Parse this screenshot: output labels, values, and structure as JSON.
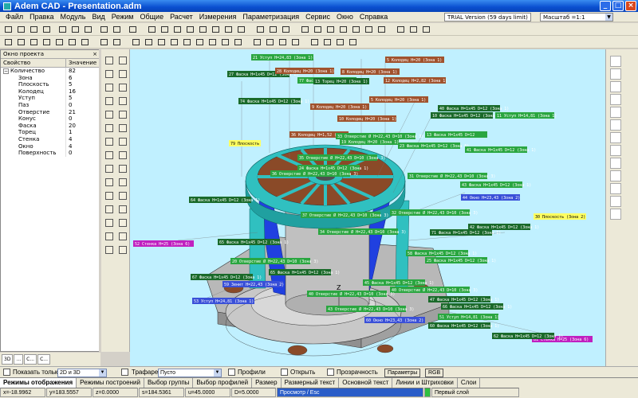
{
  "window": {
    "title": "Adem CAD - Presentation.adm"
  },
  "menu": [
    "Файл",
    "Правка",
    "Модуль",
    "Вид",
    "Режим",
    "Общие",
    "Расчет",
    "Измерения",
    "Параметризация",
    "Сервис",
    "Окно",
    "Справка"
  ],
  "trial_text": "TRIAL Version (59 days limit)",
  "zoom_text": "Масштаб =1:1",
  "project_panel": {
    "caption": "Окно проекта",
    "col_prop": "Свойство",
    "col_value": "Значение",
    "root": {
      "name": "Количество",
      "value": "82"
    },
    "rows": [
      {
        "name": "Зона",
        "value": "6"
      },
      {
        "name": "Плоскость",
        "value": "5"
      },
      {
        "name": "Колодец",
        "value": "16"
      },
      {
        "name": "Уступ",
        "value": "5"
      },
      {
        "name": "Паз",
        "value": "0"
      },
      {
        "name": "Отверстие",
        "value": "21"
      },
      {
        "name": "Конус",
        "value": "0"
      },
      {
        "name": "Фаска",
        "value": "20"
      },
      {
        "name": "Торец",
        "value": "1"
      },
      {
        "name": "Стенка",
        "value": "4"
      },
      {
        "name": "Окно",
        "value": "4"
      },
      {
        "name": "Поверхность",
        "value": "0"
      }
    ]
  },
  "left_tabs": [
    "3D",
    "...",
    "C...",
    "C..."
  ],
  "options": {
    "show_only_label": "Показать только",
    "show_only_value": "2D и 3D",
    "stencil_label": "Трафарет",
    "stencil_value": "Пусто",
    "profiles_label": "Профили",
    "open_label": "Открыть",
    "transparency_label": "Прозрачность",
    "params_button": "Параметры",
    "rgb_button": "RGB"
  },
  "bottom_tabs": [
    "Режимы отображения",
    "Режимы построений",
    "Выбор группы",
    "Выбор профилей",
    "Размер",
    "Размерный текст",
    "Основной текст",
    "Линии и Штриховки",
    "Слои"
  ],
  "status": {
    "x": "x=-18.9962",
    "y": "y=183.5557",
    "z": "z=0.0000",
    "s": "s=184.5361",
    "u": "u=45.0000",
    "d": "D=5.0000",
    "mode": "Просмотр / Esc",
    "layer": "Первый слой"
  },
  "viewport_axis_label": "Z",
  "viewport_labels": [
    "21 Уступ H=24,83 (Зона 1)",
    "5 Колодец H=20 (Зона 1)",
    "27 Фаска H=1x45 D=12 (Зона 1)",
    "28 Колодец H=20 (Зона 1)",
    "8 Колодец H=20 (Зона 1)",
    "77 Фаска H=1x45 D=12 (Зона 1)",
    "13 Торец H=20 (Зона 1)",
    "12 Колодец H=2,82 (Зона 1)",
    "74 Фаска H=1x45 D=12 (Зона 1)",
    "5 Колодец H=20 (Зона 1)",
    "9 Колодец H=20 (Зона 1)",
    "40 Фаска H=1x45 D=12 (Зона 1)",
    "10 Колодец H=20 (Зона 1)",
    "10 Фаска H=1x45 D=12 (Зона 1)",
    "11 Уступ H=14,81 (Зона 1)",
    "36 Колодец H=1,52 (Зона 1)",
    "33 Отверстие Ø H=22,43 D=10 (Зона 3)",
    "13 Фаска H=1x45 D=12",
    "79 Плоскость",
    "19 Колодец H=20 (Зона 1)",
    "23 Фаска H=1x45 D=12 (Зона 6)",
    "35 Отверстие Ø H=22,43 D=10 (Зона 3)",
    "41 Фаска H=1x45 D=12 (Зона 1)",
    "24 Фаска H=1x45 D=12 (Зона 1)",
    "36 Отверстие Ø H=22,43 D=10 (Зона 3)",
    "31 Отверстие Ø H=22,43 D=10 (Зона 3)",
    "43 Фаска H=1x45 D=12 (Зона 1)",
    "44 Окно H=23,43 (Зона 2)",
    "64 Фаска H=1x45 D=12 (Зона 1)",
    "37 Отверстие Ø H=22,43 D=10 (Зона 3)",
    "32 Отверстие Ø H=22,43 D=10 (Зона 3)",
    "42 Фаска H=1x45 D=12 (Зона 1)",
    "30 Плоскость (Зона 2)",
    "71 Фаска H=1x45 D=12 (Зона 1)",
    "52 Стенка H=25 (Зона 6)",
    "65 Фаска H=1x45 D=12 (Зона 1)",
    "34 Отверстие Ø H=22,43 D=10 (Зона 3)",
    "58 Фаска H=1x45 D=12 (Зона 1)",
    "25 Фаска H=1x45 D=12 (Зона 1)",
    "20 Отверстие Ø H=22,43 D=10 (Зона 3)",
    "65 Фаска H=1x45 D=12 (Зона 1)",
    "67 Фаска H=1x45 D=12 (Зона 1)",
    "59 Зенит H=22,43 (Зона 2)",
    "45 Фаска H=1x45 D=12 (Зона 1)",
    "40 Отверстие Ø H=22,43 D=10 (Зона 3)",
    "53 Уступ H=24,81 (Зона 1)",
    "40 Отверстие Ø H=22,43 D=10 (Зона 3)",
    "47 Фаска H=1x45 D=12 (Зона 1)",
    "43 Отверстие Ø H=22,43 D=10 (Зона 3)",
    "66 Фаска H=1x45 D=12 (Зона 1)",
    "60 Окно H=23,43 (Зона 2)",
    "51 Уступ H=14,81 (Зона 1)",
    "60 Фаска H=1x45 D=12 (Зона 1)",
    "81 Стенка H=25 (Зона 6)",
    "62 Фаска H=1x45 D=12 (Зона 1)"
  ],
  "colors": {
    "viewport_bg": "#c0f0ff",
    "label_green": "#2aa640",
    "label_dark": "#1a6a2a",
    "label_brown": "#a0522d",
    "label_blue": "#3a50d8",
    "label_magenta": "#c020c0",
    "label_yellow": "#ffff60",
    "model_cyan": "#30c0c0",
    "model_gray": "#b8b8b8",
    "model_blue": "#2040e0",
    "model_brown": "#8a4a28"
  }
}
